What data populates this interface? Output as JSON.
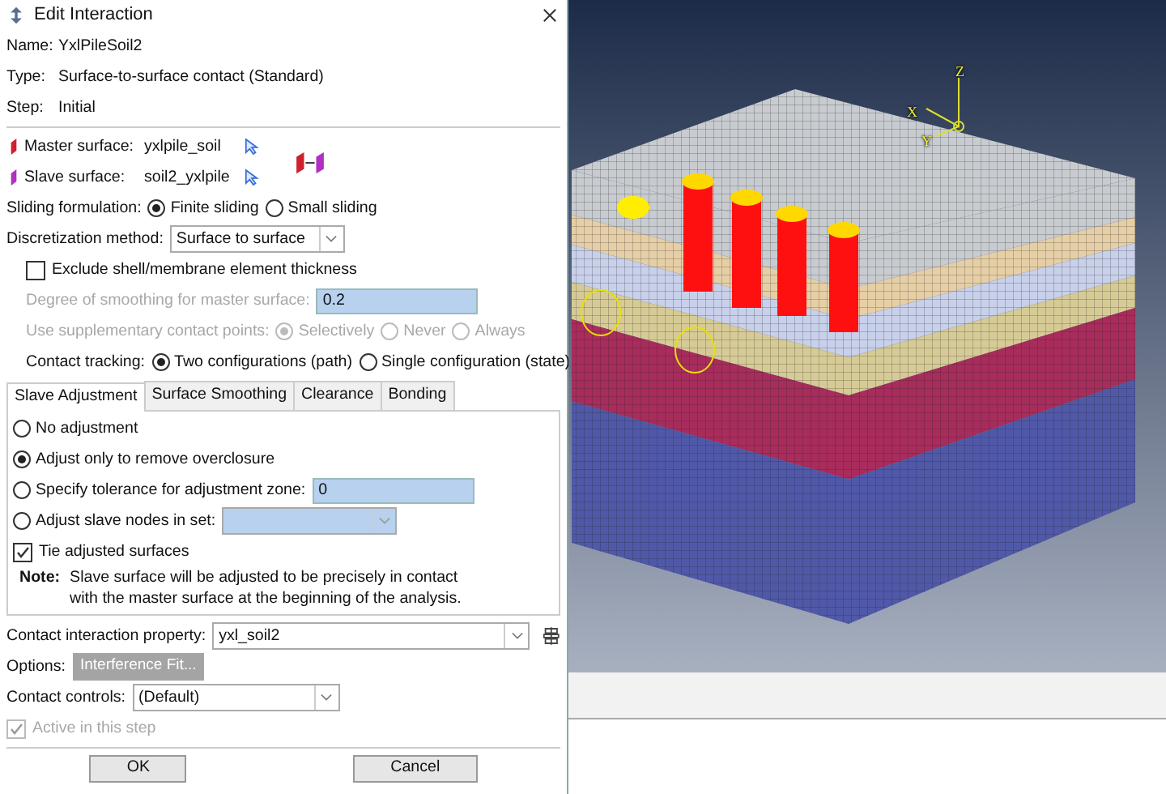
{
  "window": {
    "title": "Edit Interaction"
  },
  "info": [
    {
      "label": "Name:",
      "value": "YxlPileSoil2"
    },
    {
      "label": "Type:",
      "value": "Surface-to-surface contact (Standard)"
    },
    {
      "label": "Step:",
      "value": "Initial"
    }
  ],
  "surfaces": [
    {
      "kind": "master",
      "label": "Master surface:",
      "value": "yxlpile_soil"
    },
    {
      "kind": "slave",
      "label": "Slave surface:",
      "value": "soil2_yxlpile"
    }
  ],
  "sliding": {
    "label": "Sliding formulation:",
    "options": [
      {
        "label": "Finite sliding",
        "selected": true
      },
      {
        "label": "Small sliding",
        "selected": false
      }
    ]
  },
  "discretization": {
    "label": "Discretization method:",
    "value": "Surface to surface"
  },
  "exclude_thickness": {
    "label": "Exclude shell/membrane element thickness",
    "checked": false
  },
  "smoothing_degree": {
    "label": "Degree of smoothing for master surface:",
    "value": "0.2",
    "disabled": true
  },
  "supplementary": {
    "label": "Use supplementary contact points:",
    "disabled": true,
    "options": [
      {
        "label": "Selectively",
        "selected": true
      },
      {
        "label": "Never",
        "selected": false
      },
      {
        "label": "Always",
        "selected": false
      }
    ]
  },
  "tracking": {
    "label": "Contact tracking:",
    "options": [
      {
        "label": "Two configurations (path)",
        "selected": true
      },
      {
        "label": "Single configuration (state)",
        "selected": false
      }
    ]
  },
  "tabs": [
    {
      "label": "Slave Adjustment",
      "selected": true
    },
    {
      "label": "Surface Smoothing",
      "selected": false
    },
    {
      "label": "Clearance",
      "selected": false
    },
    {
      "label": "Bonding",
      "selected": false
    }
  ],
  "adjustment_options": [
    {
      "kind": "plain",
      "label": "No adjustment",
      "selected": false
    },
    {
      "kind": "plain",
      "label": "Adjust only to remove overclosure",
      "selected": true
    },
    {
      "kind": "field",
      "label": "Specify tolerance for adjustment zone:",
      "value": "0",
      "selected": false
    },
    {
      "kind": "dropdown",
      "label": "Adjust slave nodes in set:",
      "selected": false
    }
  ],
  "tie_surfaces": {
    "label": "Tie adjusted surfaces",
    "checked": true
  },
  "note": {
    "label": "Note:",
    "lines": [
      "Slave surface will be adjusted to be precisely in contact",
      "with the master surface at the beginning of the analysis."
    ]
  },
  "property": {
    "label": "Contact interaction property:",
    "value": "yxl_soil2"
  },
  "options": {
    "label": "Options:",
    "button": "Interference Fit...",
    "disabled": true
  },
  "controls": {
    "label": "Contact controls:",
    "value": "(Default)"
  },
  "active": {
    "label": "Active in this step",
    "checked": true,
    "disabled": true
  },
  "buttons": [
    "OK",
    "Cancel"
  ],
  "viewport": {
    "axes": [
      "Z",
      "X",
      "Y"
    ]
  }
}
